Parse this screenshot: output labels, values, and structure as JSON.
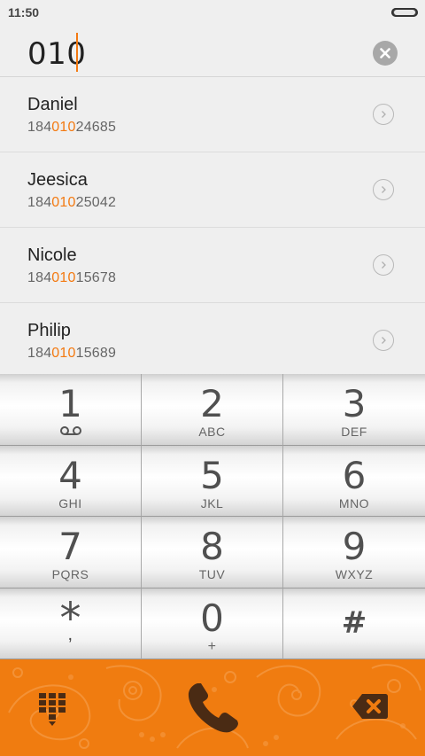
{
  "status": {
    "time": "11:50"
  },
  "dialer": {
    "input": "010"
  },
  "contacts": [
    {
      "name": "Daniel",
      "number_prefix": "184",
      "number_match": "010",
      "number_suffix": "24685"
    },
    {
      "name": "Jeesica",
      "number_prefix": "184",
      "number_match": "010",
      "number_suffix": "25042"
    },
    {
      "name": "Nicole",
      "number_prefix": "184",
      "number_match": "010",
      "number_suffix": "15678"
    },
    {
      "name": "Philip",
      "number_prefix": "184",
      "number_match": "010",
      "number_suffix": "15689"
    }
  ],
  "keys": [
    {
      "digit": "1",
      "letters": ""
    },
    {
      "digit": "2",
      "letters": "ABC"
    },
    {
      "digit": "3",
      "letters": "DEF"
    },
    {
      "digit": "4",
      "letters": "GHI"
    },
    {
      "digit": "5",
      "letters": "JKL"
    },
    {
      "digit": "6",
      "letters": "MNO"
    },
    {
      "digit": "7",
      "letters": "PQRS"
    },
    {
      "digit": "8",
      "letters": "TUV"
    },
    {
      "digit": "9",
      "letters": "WXYZ"
    },
    {
      "digit": "*",
      "letters": ","
    },
    {
      "digit": "0",
      "letters": "+"
    },
    {
      "digit": "#",
      "letters": ""
    }
  ],
  "colors": {
    "accent": "#f07c10",
    "highlight": "#f37a12",
    "icon_dark": "#4a2b14"
  }
}
